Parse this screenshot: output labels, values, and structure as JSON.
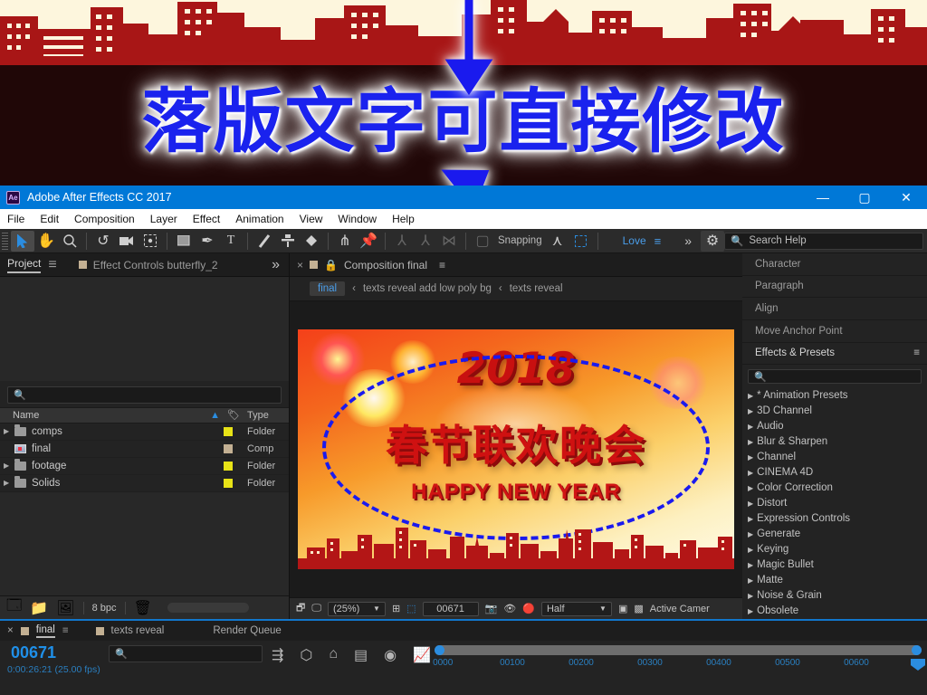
{
  "promo": {
    "headline": "落版文字可直接修改",
    "headline_color": "#1a22ee",
    "banner_color": "#a81616",
    "background": "#200707"
  },
  "window": {
    "title": "Adobe After Effects CC 2017",
    "logo_text": "Ae",
    "titlebar_color": "#0078d7",
    "controls": {
      "minimize": "—",
      "maximize": "▢",
      "close": "✕"
    }
  },
  "menu": {
    "items": [
      "File",
      "Edit",
      "Composition",
      "Layer",
      "Effect",
      "Animation",
      "View",
      "Window",
      "Help"
    ]
  },
  "toolbar": {
    "tools": [
      {
        "name": "selection-tool",
        "glyph": "➤",
        "selected": true
      },
      {
        "name": "hand-tool",
        "glyph": "✋",
        "selected": false
      },
      {
        "name": "zoom-tool",
        "glyph": "🔍",
        "selected": false
      },
      {
        "name": "rotation-tool",
        "glyph": "↺",
        "selected": false
      },
      {
        "name": "camera-tool",
        "glyph": "🎥",
        "selected": false
      },
      {
        "name": "pan-behind-tool",
        "glyph": "⛶",
        "selected": false
      },
      {
        "name": "shape-tool",
        "glyph": "▭",
        "selected": false
      },
      {
        "name": "pen-tool",
        "glyph": "✒",
        "selected": false
      },
      {
        "name": "type-tool",
        "glyph": "T",
        "selected": false
      },
      {
        "name": "brush-tool",
        "glyph": "🖌",
        "selected": false
      },
      {
        "name": "clone-stamp-tool",
        "glyph": "⊥",
        "selected": false
      },
      {
        "name": "eraser-tool",
        "glyph": "◆",
        "selected": false
      },
      {
        "name": "roto-brush-tool",
        "glyph": "⋔",
        "selected": false
      },
      {
        "name": "puppet-pin-tool",
        "glyph": "📌",
        "selected": false
      }
    ],
    "snapping_label": "Snapping",
    "workspace_label": "Love",
    "search_help_placeholder": "Search Help",
    "overflow_label": "»"
  },
  "project_panel": {
    "tabs": [
      {
        "label": "Project",
        "active": true
      },
      {
        "label": "Effect Controls butterfly_2",
        "active": false
      }
    ],
    "overflow": "»",
    "search_placeholder": "",
    "columns": [
      "Name",
      "Type"
    ],
    "rows": [
      {
        "name": "comps",
        "type": "Folder",
        "swatch": "#e8e317",
        "kind": "folder",
        "expandable": true
      },
      {
        "name": "final",
        "type": "Comp",
        "swatch": "#c3b093",
        "kind": "comp",
        "expandable": false
      },
      {
        "name": "footage",
        "type": "Folder",
        "swatch": "#e8e317",
        "kind": "folder",
        "expandable": true
      },
      {
        "name": "Solids",
        "type": "Folder",
        "swatch": "#e8e317",
        "kind": "folder",
        "expandable": true
      }
    ],
    "footer": {
      "bit_depth": "8 bpc"
    }
  },
  "comp_panel": {
    "tab_label": "Composition final",
    "tab_name": "final",
    "breadcrumbs": [
      {
        "label": "final",
        "current": true
      },
      {
        "label": "texts reveal add low poly bg",
        "current": false
      },
      {
        "label": "texts reveal",
        "current": false
      }
    ],
    "poster": {
      "year": "2018",
      "chinese_title": "春节联欢晚会",
      "subtitle": "HAPPY NEW YEAR"
    },
    "footer": {
      "zoom": "(25%)",
      "frame": "00671",
      "resolution": "Half",
      "view": "Active Camer"
    }
  },
  "right_panel": {
    "headers": [
      {
        "label": "Character",
        "active": false
      },
      {
        "label": "Paragraph",
        "active": false
      },
      {
        "label": "Align",
        "active": false
      },
      {
        "label": "Move Anchor Point",
        "active": false
      },
      {
        "label": "Effects & Presets",
        "active": true
      }
    ],
    "search_placeholder": "",
    "effects": [
      "* Animation Presets",
      "3D Channel",
      "Audio",
      "Blur & Sharpen",
      "Channel",
      "CINEMA 4D",
      "Color Correction",
      "Distort",
      "Expression Controls",
      "Generate",
      "Keying",
      "Magic Bullet",
      "Matte",
      "Noise & Grain",
      "Obsolete"
    ]
  },
  "timeline": {
    "tabs": [
      {
        "label": "final",
        "active": true
      },
      {
        "label": "texts reveal",
        "active": false
      },
      {
        "label": "Render Queue",
        "active": false
      }
    ],
    "timecode": "00671",
    "timecode_sub": "0:00:26:21 (25.00 fps)",
    "search_placeholder": "",
    "ruler_ticks": [
      "0000",
      "00100",
      "00200",
      "00300",
      "00400",
      "00500",
      "00600"
    ]
  }
}
